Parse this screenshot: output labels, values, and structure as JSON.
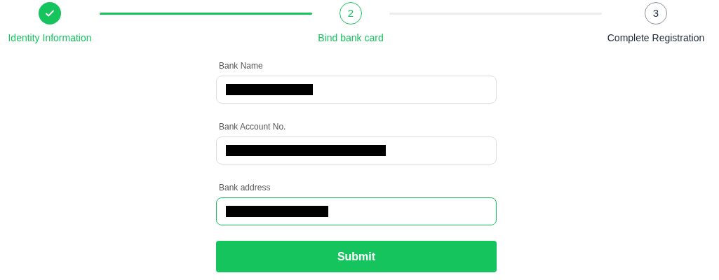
{
  "steps": [
    {
      "kind": "done",
      "label": "Identity Information"
    },
    {
      "kind": "current",
      "number": "2",
      "label": "Bind bank card"
    },
    {
      "kind": "upcoming",
      "number": "3",
      "label": "Complete Registration"
    }
  ],
  "fields": [
    {
      "label": "Bank Name",
      "redacted": true,
      "focused": false
    },
    {
      "label": "Bank Account No.",
      "redacted": true,
      "focused": false
    },
    {
      "label": "Bank address",
      "redacted": true,
      "focused": true
    }
  ],
  "submit_button": "Submit"
}
